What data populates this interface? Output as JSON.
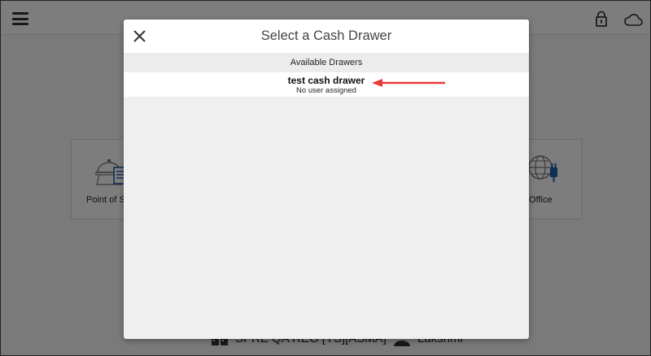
{
  "background": {
    "tiles": [
      {
        "label": "Point of S",
        "icon": "point-of-sale-icon"
      },
      {
        "label": "ck Office",
        "icon": "back-office-globe-icon"
      }
    ],
    "status_bar": {
      "register": "SPRE QA REG [YS][ASMA]",
      "user": "Lakshmi"
    }
  },
  "modal": {
    "title": "Select a Cash Drawer",
    "section_header": "Available Drawers",
    "drawers": [
      {
        "name": "test cash drawer",
        "status": "No user assigned"
      }
    ]
  },
  "colors": {
    "annotation_arrow": "#e8393a",
    "overlay": "rgba(0,0,0,0.5)"
  }
}
